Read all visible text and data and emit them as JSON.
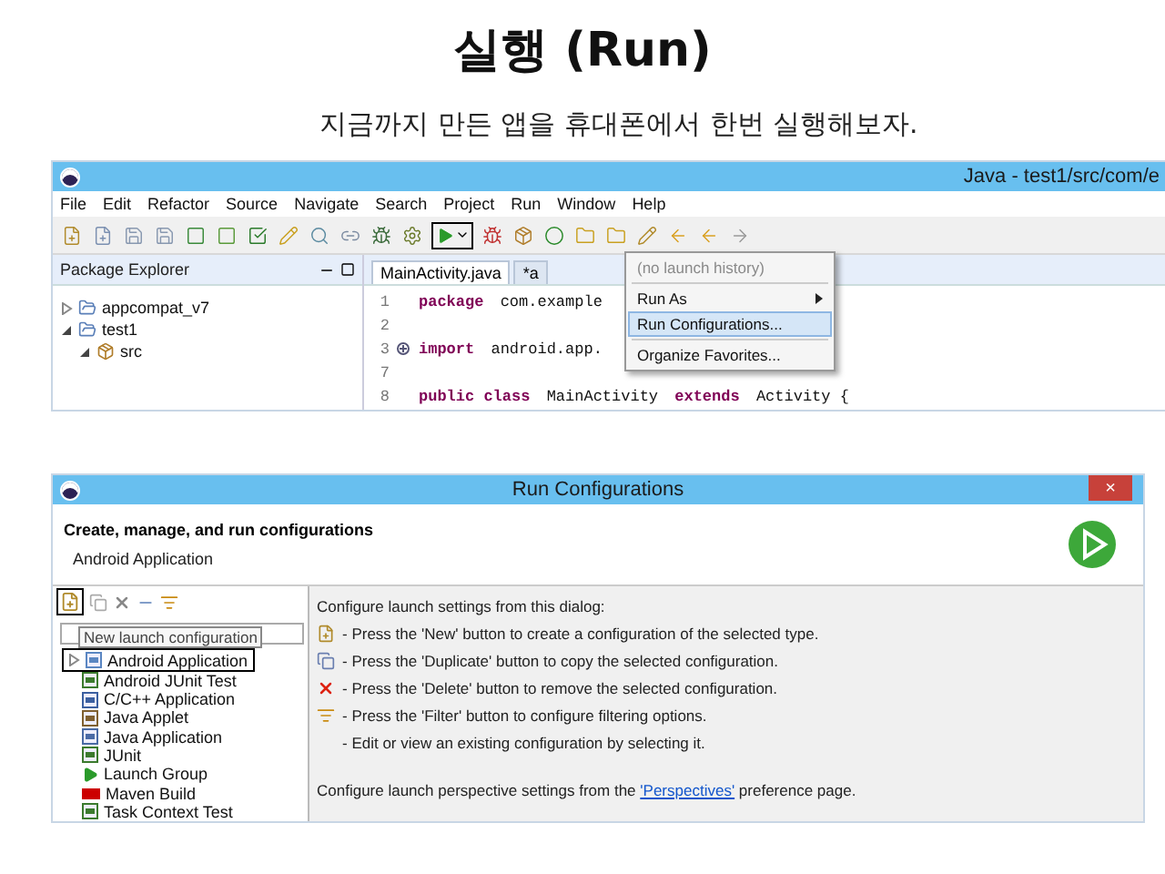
{
  "slide": {
    "title": "실행 (Run)",
    "subtitle": "지금까지 만든 앱을 휴대폰에서 한번 실행해보자."
  },
  "eclipse": {
    "title": "Java - test1/src/com/e",
    "menu": [
      "File",
      "Edit",
      "Refactor",
      "Source",
      "Navigate",
      "Search",
      "Project",
      "Run",
      "Window",
      "Help"
    ],
    "explorer": {
      "title": "Package Explorer",
      "tree": [
        {
          "label": "appcompat_v7",
          "expanded": false
        },
        {
          "label": "test1",
          "expanded": true,
          "children": [
            {
              "label": "src",
              "expanded": true
            }
          ]
        }
      ]
    },
    "editor_tabs": [
      {
        "label": "MainActivity.java",
        "selected": true
      },
      {
        "label": "*a",
        "selected": false
      }
    ],
    "code": [
      {
        "number": "1",
        "folded": false,
        "tokens": [
          {
            "text": "package ",
            "keyword": true
          },
          {
            "text": "com.example",
            "keyword": false
          }
        ]
      },
      {
        "number": "2",
        "folded": false
      },
      {
        "number": "3",
        "folded": true,
        "tokens": [
          {
            "text": "import ",
            "keyword": true
          },
          {
            "text": "android.app.",
            "keyword": false
          }
        ]
      },
      {
        "number": "7",
        "folded": false
      },
      {
        "number": "8",
        "folded": false,
        "tokens": [
          {
            "text": "public class ",
            "keyword": true
          },
          {
            "text": "MainActivity ",
            "keyword": false
          },
          {
            "text": "extends ",
            "keyword": true
          },
          {
            "text": "Activity {",
            "keyword": false
          }
        ]
      }
    ],
    "run_menu": [
      {
        "label": "(no launch history)",
        "disabled": true,
        "submenu": false,
        "selected": false
      },
      {
        "label": "Run As",
        "disabled": false,
        "submenu": true,
        "selected": false
      },
      {
        "label": "Run Configurations...",
        "disabled": false,
        "submenu": false,
        "selected": true
      },
      {
        "label": "Organize Favorites...",
        "disabled": false,
        "submenu": false,
        "selected": false
      }
    ]
  },
  "dialog": {
    "title": "Run Configurations",
    "close": "×",
    "heading": "Create, manage, and run configurations",
    "subheading": "Android Application",
    "tooltip": "New launch configuration",
    "types": [
      {
        "label": "Android Application",
        "kind": "android",
        "expanded": false
      },
      {
        "label": "Android JUnit Test",
        "kind": "junit"
      },
      {
        "label": "C/C++ Application",
        "kind": "cpp"
      },
      {
        "label": "Java Applet",
        "kind": "applet"
      },
      {
        "label": "Java Application",
        "kind": "java"
      },
      {
        "label": "JUnit",
        "kind": "junit"
      },
      {
        "label": "Launch Group",
        "kind": "group"
      },
      {
        "label": "Maven Build",
        "kind": "maven"
      },
      {
        "label": "Task Context Test",
        "kind": "junit"
      }
    ],
    "intro": "Configure launch settings from this dialog:",
    "hints": [
      {
        "kind": "new",
        "text": "- Press the 'New' button to create a configuration of the selected type."
      },
      {
        "kind": "duplicate",
        "text": "- Press the 'Duplicate' button to copy the selected configuration."
      },
      {
        "kind": "delete",
        "text": "- Press the 'Delete' button to remove the selected configuration."
      },
      {
        "kind": "filter",
        "text": "- Press the 'Filter' button to configure filtering options."
      },
      {
        "kind": "none",
        "text": "- Edit or view an existing configuration by selecting it."
      }
    ],
    "footer": {
      "before": "Configure launch perspective settings from the ",
      "link": "'Perspectives'",
      "after": " preference page."
    }
  }
}
